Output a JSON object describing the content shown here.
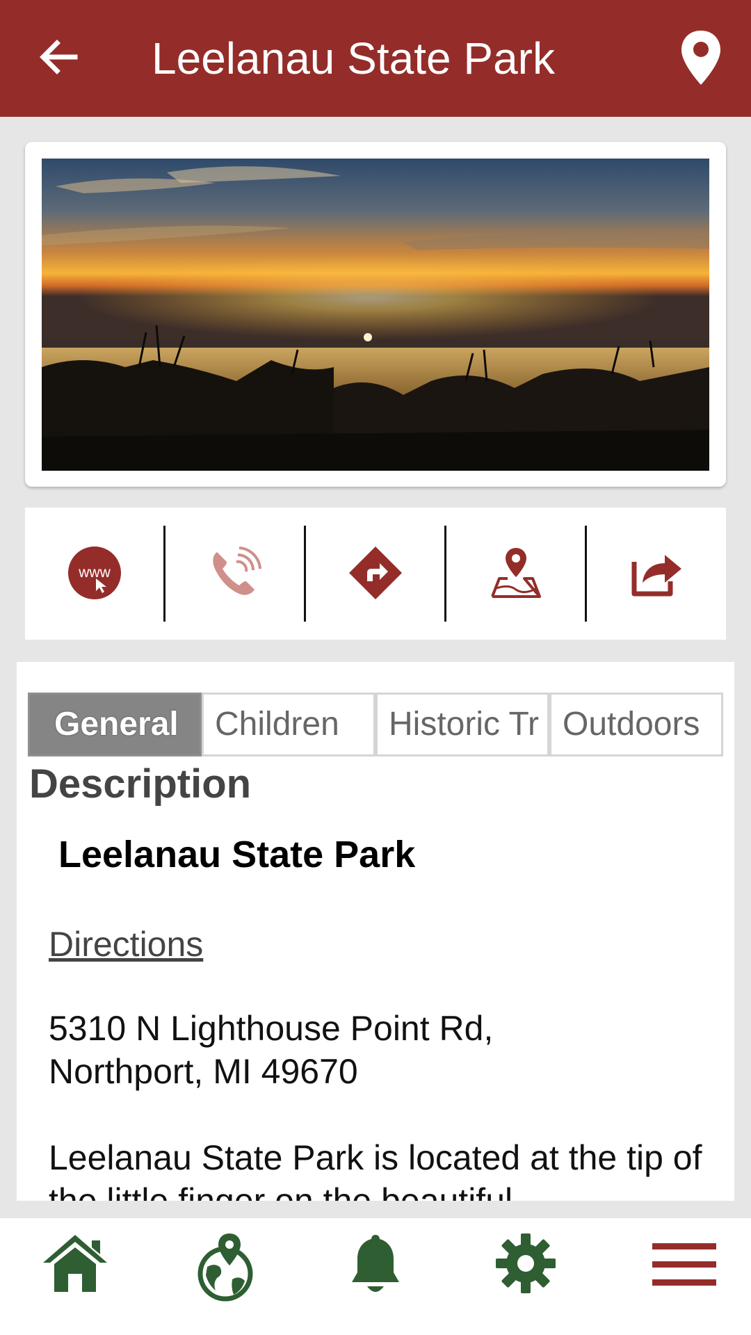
{
  "header": {
    "title": "Leelanau State Park",
    "back_icon": "arrow-left-icon",
    "location_icon": "map-pin-icon"
  },
  "photo": {
    "description": "sunset-over-lake-photo"
  },
  "actions": [
    {
      "icon": "website-www-icon"
    },
    {
      "icon": "phone-call-icon"
    },
    {
      "icon": "directions-icon"
    },
    {
      "icon": "map-location-icon"
    },
    {
      "icon": "share-icon"
    }
  ],
  "tabs": [
    {
      "label": "General",
      "active": true
    },
    {
      "label": "Children",
      "active": false
    },
    {
      "label": "Historic Tr",
      "active": false
    },
    {
      "label": "Outdoors",
      "active": false
    }
  ],
  "content": {
    "heading": "Description",
    "park_name": "Leelanau State Park",
    "directions_link": "Directions",
    "address_line1": "5310 N Lighthouse Point Rd,",
    "address_line2": "Northport, MI 49670",
    "paragraph": "Leelanau State Park is located at the tip of the little finger on the beautiful"
  },
  "bottom_nav": [
    {
      "icon": "home-icon"
    },
    {
      "icon": "globe-location-icon"
    },
    {
      "icon": "bell-icon"
    },
    {
      "icon": "gear-icon"
    },
    {
      "icon": "hamburger-menu-icon"
    }
  ],
  "colors": {
    "brand_red": "#942d29",
    "nav_green": "#2e5e32",
    "tab_active": "#858585"
  }
}
